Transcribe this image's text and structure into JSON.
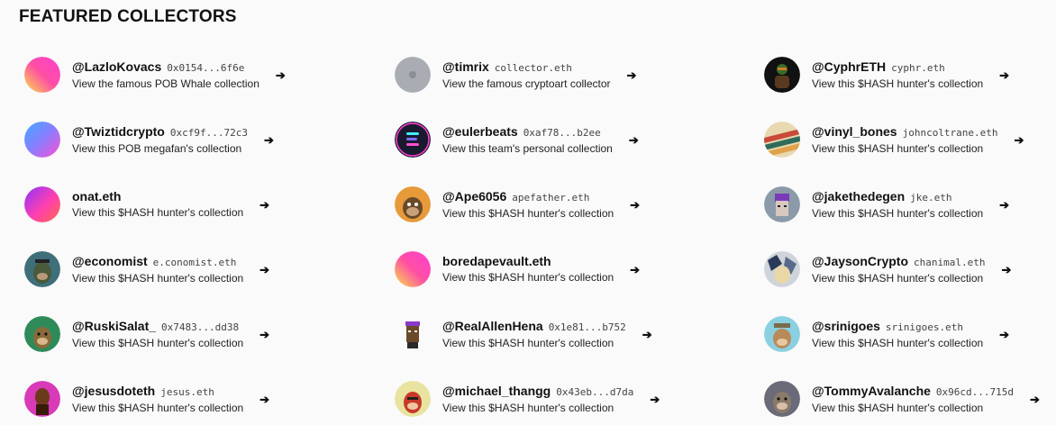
{
  "section_title": "FEATURED COLLECTORS",
  "collectors": [
    {
      "handle": "@LazloKovacs",
      "address": "0x0154...6f6e",
      "description": "View the famous POB Whale collection",
      "avatar": "gradient-pink-orange-avatar"
    },
    {
      "handle": "@timrix",
      "address": "collector.eth",
      "description": "View the famous cryptoart collector",
      "avatar": "gray-circle-avatar"
    },
    {
      "handle": "@CyphrETH",
      "address": "cyphr.eth",
      "description": "View this $HASH hunter's collection",
      "avatar": "dark-figure-avatar"
    },
    {
      "handle": "@Twiztidcrypto",
      "address": "0xcf9f...72c3",
      "description": "View this POB megafan's collection",
      "avatar": "gradient-blue-pink-avatar"
    },
    {
      "handle": "@eulerbeats",
      "address": "0xaf78...b2ee",
      "description": "View this team's personal collection",
      "avatar": "eulerbeats-logo-avatar"
    },
    {
      "handle": "@vinyl_bones",
      "address": "johncoltrane.eth",
      "description": "View this $HASH hunter's collection",
      "avatar": "striped-art-avatar"
    },
    {
      "handle": "onat.eth",
      "address": "",
      "description": "View this $HASH hunter's collection",
      "avatar": "gradient-purple-pink-avatar"
    },
    {
      "handle": "@Ape6056",
      "address": "apefather.eth",
      "description": "View this $HASH hunter's collection",
      "avatar": "ape-orange-avatar"
    },
    {
      "handle": "@jakethedegen",
      "address": "jke.eth",
      "description": "View this $HASH hunter's collection",
      "avatar": "purple-hair-punk-avatar"
    },
    {
      "handle": "@economist",
      "address": "e.conomist.eth",
      "description": "View this $HASH hunter's collection",
      "avatar": "teal-ape-avatar"
    },
    {
      "handle": "boredapevault.eth",
      "address": "",
      "description": "View this $HASH hunter's collection",
      "avatar": "gradient-pink-orange-avatar"
    },
    {
      "handle": "@JaysonCrypto",
      "address": "chanimal.eth",
      "description": "View this $HASH hunter's collection",
      "avatar": "patterned-ape-avatar"
    },
    {
      "handle": "@RuskiSalat_",
      "address": "0x7483...dd38",
      "description": "View this $HASH hunter's collection",
      "avatar": "green-ape-avatar"
    },
    {
      "handle": "@RealAllenHena",
      "address": "0x1e81...b752",
      "description": "View this $HASH hunter's collection",
      "avatar": "pixel-punk-avatar"
    },
    {
      "handle": "@srinigoes",
      "address": "srinigoes.eth",
      "description": "View this $HASH hunter's collection",
      "avatar": "blue-ape-avatar"
    },
    {
      "handle": "@jesusdoteth",
      "address": "jesus.eth",
      "description": "View this $HASH hunter's collection",
      "avatar": "magenta-figure-avatar"
    },
    {
      "handle": "@michael_thangg",
      "address": "0x43eb...d7da",
      "description": "View this $HASH hunter's collection",
      "avatar": "yellow-ape-avatar"
    },
    {
      "handle": "@TommyAvalanche",
      "address": "0x96cd...715d",
      "description": "View this $HASH hunter's collection",
      "avatar": "gray-ape-avatar"
    }
  ],
  "arrow_glyph": "➔"
}
